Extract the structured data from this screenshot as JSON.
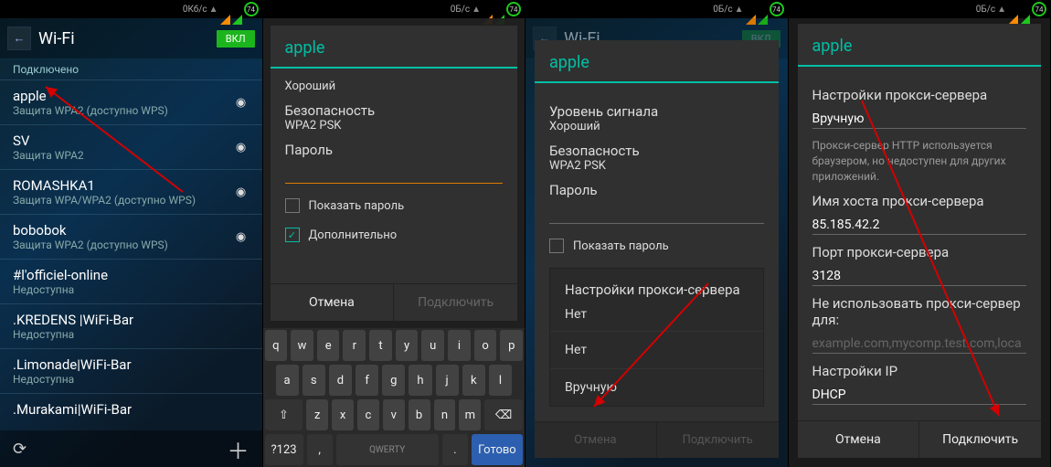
{
  "status": {
    "speed": "0Кб/с",
    "speed_zero": "0Б/с",
    "battery": "74"
  },
  "header": {
    "title": "Wi-Fi",
    "toggle": "ВКЛ",
    "connected": "Подключено"
  },
  "wifi": [
    {
      "name": "apple",
      "sub": "Защита WPA2 (доступно WPS)"
    },
    {
      "name": "SV",
      "sub": "Защита WPA2"
    },
    {
      "name": "ROMASHKA1",
      "sub": "Защита WPA/WPA2 (доступно WPS)"
    },
    {
      "name": "bobobok",
      "sub": "Защита WPA2 (доступно WPS)"
    },
    {
      "name": "#l'officiel-online",
      "sub": "Недоступна"
    },
    {
      "name": ".KREDENS |WiFi-Bar",
      "sub": "Недоступна"
    },
    {
      "name": ".Limonade|WiFi-Bar",
      "sub": "Недоступна"
    },
    {
      "name": ".Murakami|WiFi-Bar",
      "sub": ""
    }
  ],
  "dlg": {
    "title": "apple",
    "signal_label": "Уровень сигнала",
    "signal_value": "Хороший",
    "security_label": "Безопасность",
    "security_value": "WPA2 PSK",
    "password_label": "Пароль",
    "show_password": "Показать пароль",
    "advanced": "Дополнительно",
    "proxy_label": "Настройки прокси-сервера",
    "proxy_none": "Нет",
    "proxy_manual": "Вручную",
    "proxy_help": "Прокси-сервер HTTP используется браузером, но недоступен для других приложений.",
    "proxy_host_label": "Имя хоста прокси-сервера",
    "proxy_host_value": "85.185.42.2",
    "proxy_port_label": "Порт прокси-сервера",
    "proxy_port_value": "3128",
    "bypass_label": "Не использовать прокси-сервер для:",
    "bypass_placeholder": "example.com,mycomp.test.com,loca",
    "ip_label": "Настройки IP",
    "ip_value": "DHCP",
    "cancel": "Отмена",
    "connect": "Подключить"
  },
  "kb": {
    "r1": [
      "q",
      "w",
      "e",
      "r",
      "t",
      "y",
      "u",
      "i",
      "o",
      "p"
    ],
    "r2": [
      "a",
      "s",
      "d",
      "f",
      "g",
      "h",
      "j",
      "k",
      "l"
    ],
    "r3": [
      "z",
      "x",
      "c",
      "v",
      "b",
      "n",
      "m"
    ],
    "shift": "⇧",
    "back": "⌫",
    "sym": "?123",
    "comma": ",",
    "space": "QWERTY",
    "dot": ".",
    "done": "Готово"
  }
}
